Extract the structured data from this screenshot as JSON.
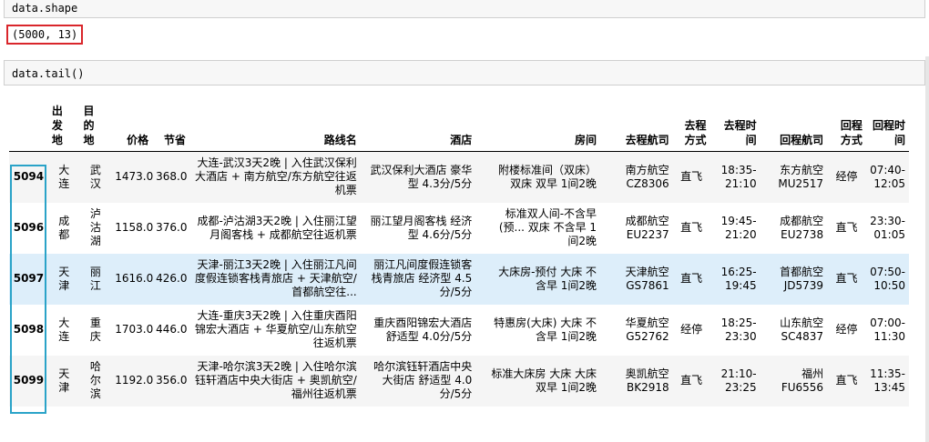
{
  "cell1": {
    "code": "data.shape",
    "output": "(5000, 13)"
  },
  "cell2": {
    "code": "data.tail()"
  },
  "table": {
    "columns": [
      "出\n发\n地",
      "目\n的\n地",
      "价格",
      "节省",
      "路线名",
      "酒店",
      "房间",
      "去程航司",
      "去程\n方式",
      "去程时\n间",
      "回程航司",
      "回程\n方式",
      "回程时\n间"
    ],
    "rows": [
      {
        "index": "5094",
        "values": [
          "大\n连",
          "武\n汉",
          "1473.0",
          "368.0",
          "大连-武汉3天2晚 | 入住武汉保利\n大酒店 + 南方航空/东方航空往返\n机票",
          "武汉保利大酒店 豪华\n型 4.3分/5分",
          "附楼标准间（双床）\n双床 双早 1间2晚",
          "南方航空\nCZ8306",
          "直飞",
          "18:35-\n21:10",
          "东方航空\nMU2517",
          "经停",
          "07:40-\n12:05"
        ]
      },
      {
        "index": "5096",
        "values": [
          "成\n都",
          "泸\n沽\n湖",
          "1158.0",
          "376.0",
          "成都-泸沽湖3天2晚 | 入住丽江望\n月阁客栈 + 成都航空往返机票",
          "丽江望月阁客栈 经济\n型 4.6分/5分",
          "标准双人间-不含早\n(预... 双床 不含早 1\n间2晚",
          "成都航空\nEU2237",
          "直飞",
          "19:45-\n21:20",
          "成都航空\nEU2738",
          "直飞",
          "23:30-\n01:05"
        ]
      },
      {
        "index": "5097",
        "values": [
          "天\n津",
          "丽\n江",
          "1616.0",
          "426.0",
          "天津-丽江3天2晚 | 入住丽江凡间\n度假连锁客栈青旅店 + 天津航空/\n首都航空往...",
          "丽江凡间度假连锁客\n栈青旅店 经济型 4.5\n分/5分",
          "大床房-预付 大床 不\n含早 1间2晚",
          "天津航空\nGS7861",
          "直飞",
          "16:25-\n19:45",
          "首都航空\nJD5739",
          "直飞",
          "07:50-\n10:50"
        ]
      },
      {
        "index": "5098",
        "values": [
          "大\n连",
          "重\n庆",
          "1703.0",
          "446.0",
          "大连-重庆3天2晚 | 入住重庆酉阳\n锦宏大酒店 + 华夏航空/山东航空\n往返机票",
          "重庆酉阳锦宏大酒店\n舒适型 4.0分/5分",
          "特惠房(大床) 大床 不\n含早 1间2晚",
          "华夏航空\nG52762",
          "经停",
          "18:25-\n23:30",
          "山东航空\nSC4837",
          "经停",
          "07:00-\n11:30"
        ]
      },
      {
        "index": "5099",
        "values": [
          "天\n津",
          "哈\n尔\n滨",
          "1192.0",
          "356.0",
          "天津-哈尔滨3天2晚 | 入住哈尔滨\n钰轩酒店中央大街店 + 奥凯航空/\n福州往返机票",
          "哈尔滨钰轩酒店中央\n大街店 舒适型 4.0\n分/5分",
          "标准大床房 大床 大床\n双早 1间2晚",
          "奥凯航空\nBK2918",
          "直飞",
          "21:10-\n23:25",
          "福州\nFU6556",
          "直飞",
          "11:35-\n13:45"
        ]
      }
    ]
  },
  "colors": {
    "output_highlight": "#d9262b",
    "index_selection": "#2aa3c8",
    "hover_row": "#ddeefa"
  }
}
